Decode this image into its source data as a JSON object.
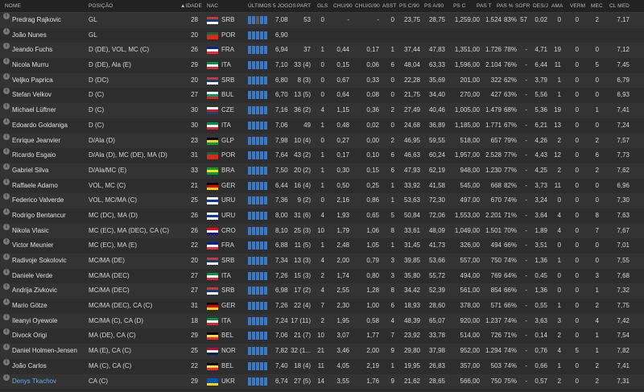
{
  "columns": {
    "nome": "NOME",
    "posicao": "POSIÇÃO",
    "idade": "IDADE",
    "nac": "NAC",
    "form": "ÚLTIMOS 5 JOGOS",
    "part": "PART",
    "gls": "GLS",
    "chu90": "CHU/90",
    "chug90": "CHU/G/90",
    "asst": "ASST",
    "psc90": "PS C/90",
    "pa90": "PS A/90",
    "psc": "PS C",
    "past": "PAS T",
    "paspct": "PAS %",
    "sofr": "SOFR",
    "desj": "DES/J",
    "ama": "AMA",
    "verm": "VERM",
    "mec": "MEC",
    "clmed": "CL MED"
  },
  "players": [
    {
      "name": "Predrag Rajkovic",
      "pos": "GL",
      "age": "28",
      "nat": "SRB",
      "form": [
        9,
        7,
        4,
        9,
        9
      ],
      "rating": "7,08",
      "part": "53",
      "gls": "0",
      "chu90": "-",
      "chug90": "-",
      "asst": "0",
      "psc90": "23,75",
      "pa90": "28,75",
      "psc": "1,259,00",
      "past": "1.524",
      "paspct": "83%",
      "sofr": "57",
      "desj": "0,02",
      "ama": "0",
      "verm": "0",
      "mec": "2",
      "clmed": "7,17"
    },
    {
      "name": "João Nunes",
      "pos": "GL",
      "age": "20",
      "nat": "POR",
      "form": [
        9,
        9,
        9,
        9,
        9
      ],
      "rating": "6,90",
      "part": "",
      "gls": "",
      "chu90": "",
      "chug90": "",
      "asst": "",
      "psc90": "",
      "pa90": "",
      "psc": "",
      "past": "",
      "paspct": "",
      "sofr": "",
      "desj": "",
      "ama": "",
      "verm": "",
      "mec": "",
      "clmed": ""
    },
    {
      "name": "Jeando Fuchs",
      "pos": "D (DE), VOL, MC (C)",
      "age": "26",
      "nat": "FRA",
      "form": [
        9,
        7,
        9,
        9,
        9
      ],
      "rating": "6,94",
      "part": "37",
      "gls": "1",
      "chu90": "0,44",
      "chug90": "0,17",
      "asst": "1",
      "psc90": "37,44",
      "pa90": "47,83",
      "psc": "1,351,00",
      "past": "1.726",
      "paspct": "78%",
      "sofr": "-",
      "desj": "4,71",
      "ama": "19",
      "verm": "0",
      "mec": "0",
      "clmed": "7,12"
    },
    {
      "name": "Nicola Murru",
      "pos": "D (DE), Ala (E)",
      "age": "29",
      "nat": "ITA",
      "form": [
        9,
        9,
        9,
        9,
        9
      ],
      "rating": "7,10",
      "part": "33 (4)",
      "gls": "0",
      "chu90": "0,15",
      "chug90": "0,06",
      "asst": "6",
      "psc90": "48,04",
      "pa90": "63,33",
      "psc": "1,596,00",
      "past": "2.104",
      "paspct": "76%",
      "sofr": "-",
      "desj": "6,44",
      "ama": "11",
      "verm": "0",
      "mec": "5",
      "clmed": "7,45"
    },
    {
      "name": "Veljko Paprica",
      "pos": "D (DC)",
      "age": "20",
      "nat": "SRB",
      "form": [
        9,
        9,
        9,
        9,
        9
      ],
      "rating": "6,80",
      "part": "8 (3)",
      "gls": "0",
      "chu90": "0,67",
      "chug90": "0,33",
      "asst": "0",
      "psc90": "22,28",
      "pa90": "35,69",
      "psc": "201,00",
      "past": "322",
      "paspct": "62%",
      "sofr": "-",
      "desj": "3,79",
      "ama": "1",
      "verm": "0",
      "mec": "0",
      "clmed": "6,79"
    },
    {
      "name": "Stefan Velkov",
      "pos": "D (C)",
      "age": "27",
      "nat": "BUL",
      "form": [
        9,
        9,
        9,
        9,
        9
      ],
      "rating": "6,70",
      "part": "13 (5)",
      "gls": "0",
      "chu90": "0,64",
      "chug90": "0,08",
      "asst": "0",
      "psc90": "21,75",
      "pa90": "34,40",
      "psc": "270,00",
      "past": "427",
      "paspct": "63%",
      "sofr": "-",
      "desj": "5,56",
      "ama": "1",
      "verm": "0",
      "mec": "0",
      "clmed": "6,93"
    },
    {
      "name": "Michael Lüftner",
      "pos": "D (C)",
      "age": "30",
      "nat": "CZE",
      "form": [
        9,
        9,
        9,
        9,
        9
      ],
      "rating": "7,16",
      "part": "36 (2)",
      "gls": "4",
      "chu90": "1,15",
      "chug90": "0,36",
      "asst": "2",
      "psc90": "27,49",
      "pa90": "40,46",
      "psc": "1,005,00",
      "past": "1.479",
      "paspct": "68%",
      "sofr": "-",
      "desj": "5,36",
      "ama": "19",
      "verm": "0",
      "mec": "1",
      "clmed": "7,41"
    },
    {
      "name": "Edoardo Goldaniga",
      "pos": "D (C)",
      "age": "30",
      "nat": "ITA",
      "form": [
        9,
        9,
        9,
        9,
        9
      ],
      "rating": "7,06",
      "part": "49",
      "gls": "1",
      "chu90": "0,48",
      "chug90": "0,02",
      "asst": "0",
      "psc90": "24,68",
      "pa90": "36,89",
      "psc": "1,185,00",
      "past": "1.771",
      "paspct": "67%",
      "sofr": "-",
      "desj": "6,21",
      "ama": "13",
      "verm": "0",
      "mec": "0",
      "clmed": "7,24"
    },
    {
      "name": "Enrique Jeanvier",
      "pos": "D/Ala (D)",
      "age": "23",
      "nat": "GLP",
      "form": [
        9,
        9,
        9,
        9,
        9
      ],
      "rating": "7,98",
      "part": "10 (4)",
      "gls": "0",
      "chu90": "0,27",
      "chug90": "0,00",
      "asst": "2",
      "psc90": "46,95",
      "pa90": "59,55",
      "psc": "518,00",
      "past": "657",
      "paspct": "79%",
      "sofr": "-",
      "desj": "4,26",
      "ama": "2",
      "verm": "0",
      "mec": "2",
      "clmed": "7,57"
    },
    {
      "name": "Ricardo Esgaio",
      "pos": "D/Ala (D), MC (DE), MA (D)",
      "age": "31",
      "nat": "POR",
      "form": [
        9,
        9,
        9,
        9,
        9
      ],
      "rating": "7,64",
      "part": "43 (2)",
      "gls": "1",
      "chu90": "0,17",
      "chug90": "0,10",
      "asst": "6",
      "psc90": "46,63",
      "pa90": "60,24",
      "psc": "1,957,00",
      "past": "2.528",
      "paspct": "77%",
      "sofr": "-",
      "desj": "4,43",
      "ama": "12",
      "verm": "0",
      "mec": "6",
      "clmed": "7,73"
    },
    {
      "name": "Gabriel Silva",
      "pos": "D/Ala/MC (E)",
      "age": "33",
      "nat": "BRA",
      "form": [
        9,
        9,
        9,
        9,
        9
      ],
      "rating": "7,50",
      "part": "20 (2)",
      "gls": "1",
      "chu90": "0,30",
      "chug90": "0,15",
      "asst": "6",
      "psc90": "47,93",
      "pa90": "62,19",
      "psc": "948,00",
      "past": "1.230",
      "paspct": "77%",
      "sofr": "-",
      "desj": "4,25",
      "ama": "2",
      "verm": "0",
      "mec": "2",
      "clmed": "7,62"
    },
    {
      "name": "Raffaele Adamo",
      "pos": "VOL, MC (C)",
      "age": "21",
      "nat": "GER",
      "form": [
        9,
        9,
        9,
        9,
        9
      ],
      "rating": "6,44",
      "part": "16 (4)",
      "gls": "1",
      "chu90": "0,50",
      "chug90": "0,25",
      "asst": "1",
      "psc90": "33,92",
      "pa90": "41,58",
      "psc": "545,00",
      "past": "668",
      "paspct": "82%",
      "sofr": "-",
      "desj": "3,73",
      "ama": "11",
      "verm": "0",
      "mec": "0",
      "clmed": "6,96"
    },
    {
      "name": "Federico Valverde",
      "pos": "VOL, MC/MA (C)",
      "age": "25",
      "nat": "URU",
      "form": [
        9,
        9,
        9,
        9,
        9
      ],
      "rating": "7,36",
      "part": "9 (2)",
      "gls": "0",
      "chu90": "2,16",
      "chug90": "0,86",
      "asst": "1",
      "psc90": "53,63",
      "pa90": "72,30",
      "psc": "497,00",
      "past": "670",
      "paspct": "74%",
      "sofr": "-",
      "desj": "3,24",
      "ama": "0",
      "verm": "0",
      "mec": "0",
      "clmed": "7,30"
    },
    {
      "name": "Rodrigo Bentancur",
      "pos": "MC (DC), MA (D)",
      "age": "26",
      "nat": "URU",
      "form": [
        9,
        9,
        9,
        9,
        9
      ],
      "rating": "8,00",
      "part": "31 (6)",
      "gls": "4",
      "chu90": "1,93",
      "chug90": "0,65",
      "asst": "5",
      "psc90": "50,84",
      "pa90": "72,06",
      "psc": "1,553,00",
      "past": "2.201",
      "paspct": "71%",
      "sofr": "-",
      "desj": "3,64",
      "ama": "4",
      "verm": "0",
      "mec": "8",
      "clmed": "7,63"
    },
    {
      "name": "Nikola Vlasic",
      "pos": "MC (EC), MA (DEC), CA (C)",
      "age": "26",
      "nat": "CRO",
      "form": [
        9,
        9,
        9,
        9,
        9
      ],
      "rating": "8,10",
      "part": "25 (3)",
      "gls": "10",
      "chu90": "1,79",
      "chug90": "1,06",
      "asst": "8",
      "psc90": "33,61",
      "pa90": "48,09",
      "psc": "1,049,00",
      "past": "1.501",
      "paspct": "70%",
      "sofr": "-",
      "desj": "1,89",
      "ama": "4",
      "verm": "0",
      "mec": "7",
      "clmed": "7,67"
    },
    {
      "name": "Victor Meunier",
      "pos": "MC (EC), MA (E)",
      "age": "22",
      "nat": "FRA",
      "form": [
        9,
        9,
        9,
        9,
        9
      ],
      "rating": "6,88",
      "part": "11 (5)",
      "gls": "1",
      "chu90": "2,48",
      "chug90": "1,05",
      "asst": "1",
      "psc90": "31,45",
      "pa90": "41,73",
      "psc": "326,00",
      "past": "494",
      "paspct": "66%",
      "sofr": "-",
      "desj": "3,51",
      "ama": "0",
      "verm": "0",
      "mec": "0",
      "clmed": "7,01"
    },
    {
      "name": "Radivoje Sokolovic",
      "pos": "MC/MA (DE)",
      "age": "20",
      "nat": "SRB",
      "form": [
        9,
        9,
        9,
        9,
        9
      ],
      "rating": "7,34",
      "part": "13 (3)",
      "gls": "4",
      "chu90": "2,00",
      "chug90": "0,79",
      "asst": "3",
      "psc90": "39,85",
      "pa90": "53,66",
      "psc": "557,00",
      "past": "750",
      "paspct": "74%",
      "sofr": "-",
      "desj": "1,36",
      "ama": "1",
      "verm": "0",
      "mec": "0",
      "clmed": "7,55"
    },
    {
      "name": "Daniele Verde",
      "pos": "MC/MA (DEC)",
      "age": "27",
      "nat": "ITA",
      "form": [
        9,
        9,
        9,
        9,
        9
      ],
      "rating": "7,26",
      "part": "15 (3)",
      "gls": "2",
      "chu90": "1,74",
      "chug90": "0,80",
      "asst": "3",
      "psc90": "35,80",
      "pa90": "55,72",
      "psc": "494,00",
      "past": "769",
      "paspct": "64%",
      "sofr": "-",
      "desj": "0,45",
      "ama": "0",
      "verm": "0",
      "mec": "3",
      "clmed": "7,68"
    },
    {
      "name": "Andrija Zivkovic",
      "pos": "MC/MA (DEC)",
      "age": "27",
      "nat": "SRB",
      "form": [
        9,
        9,
        9,
        9,
        9
      ],
      "rating": "6,98",
      "part": "17 (2)",
      "gls": "4",
      "chu90": "2,55",
      "chug90": "1,28",
      "asst": "8",
      "psc90": "34,42",
      "pa90": "52,39",
      "psc": "561,00",
      "past": "854",
      "paspct": "66%",
      "sofr": "-",
      "desj": "1,36",
      "ama": "0",
      "verm": "0",
      "mec": "1",
      "clmed": "7,32"
    },
    {
      "name": "Mario Götze",
      "pos": "MC/MA (DEC), CA (C)",
      "age": "31",
      "nat": "GER",
      "form": [
        9,
        9,
        9,
        9,
        9
      ],
      "rating": "7,26",
      "part": "22 (4)",
      "gls": "7",
      "chu90": "2,30",
      "chug90": "1,00",
      "asst": "6",
      "psc90": "18,93",
      "pa90": "28,60",
      "psc": "378,00",
      "past": "571",
      "paspct": "66%",
      "sofr": "-",
      "desj": "0,55",
      "ama": "1",
      "verm": "0",
      "mec": "2",
      "clmed": "7,75"
    },
    {
      "name": "Ileanyi Oyewole",
      "pos": "MC/MA (C), CA (D)",
      "age": "18",
      "nat": "ITA",
      "form": [
        9,
        9,
        9,
        9,
        9
      ],
      "rating": "7,24",
      "part": "17 (11)",
      "gls": "2",
      "chu90": "1,95",
      "chug90": "0,58",
      "asst": "4",
      "psc90": "48,39",
      "pa90": "65,07",
      "psc": "920,00",
      "past": "1.237",
      "paspct": "74%",
      "sofr": "-",
      "desj": "3,63",
      "ama": "3",
      "verm": "0",
      "mec": "4",
      "clmed": "7,42"
    },
    {
      "name": "Divock Origi",
      "pos": "MA (DE), CA (C)",
      "age": "29",
      "nat": "BEL",
      "form": [
        9,
        9,
        9,
        9,
        9
      ],
      "rating": "7,06",
      "part": "21 (7)",
      "gls": "10",
      "chu90": "3,07",
      "chug90": "1,77",
      "asst": "7",
      "psc90": "23,92",
      "pa90": "33,78",
      "psc": "514,00",
      "past": "726",
      "paspct": "71%",
      "sofr": "-",
      "desj": "0,14",
      "ama": "2",
      "verm": "0",
      "mec": "1",
      "clmed": "7,54"
    },
    {
      "name": "Daniel Holmen-Jensen",
      "pos": "MA (E), CA (C)",
      "age": "25",
      "nat": "NOR",
      "form": [
        9,
        9,
        9,
        9,
        9
      ],
      "rating": "7,82",
      "part": "32 (1...",
      "gls": "21",
      "chu90": "3,46",
      "chug90": "2,00",
      "asst": "9",
      "psc90": "29,80",
      "pa90": "37,98",
      "psc": "952,00",
      "past": "1.294",
      "paspct": "74%",
      "sofr": "-",
      "desj": "0,76",
      "ama": "4",
      "verm": "5",
      "mec": "1",
      "clmed": "7,82"
    },
    {
      "name": "João Carlos",
      "pos": "MA (C), CA (C)",
      "age": "22",
      "nat": "BEL",
      "form": [
        9,
        9,
        9,
        9,
        9
      ],
      "rating": "7,40",
      "part": "18 (4)",
      "gls": "11",
      "chu90": "4,05",
      "chug90": "2,19",
      "asst": "1",
      "psc90": "19,95",
      "pa90": "26,83",
      "psc": "357,00",
      "past": "503",
      "paspct": "74%",
      "sofr": "-",
      "desj": "0,66",
      "ama": "1",
      "verm": "0",
      "mec": "2",
      "clmed": "7,41"
    },
    {
      "name": "Denys Tkachov",
      "pos": "CA (C)",
      "age": "29",
      "nat": "UKR",
      "form": [
        9,
        9,
        9,
        9,
        9
      ],
      "rating": "6,74",
      "part": "27 (5)",
      "gls": "14",
      "chu90": "3,55",
      "chug90": "1,76",
      "asst": "9",
      "psc90": "21,62",
      "pa90": "28,65",
      "psc": "566,00",
      "past": "750",
      "paspct": "75%",
      "sofr": "-",
      "desj": "0,57",
      "ama": "2",
      "verm": "0",
      "mec": "2",
      "clmed": "7,31"
    }
  ],
  "flags": {
    "SRB": [
      "#c6363c",
      "#0c4076",
      "#ffffff"
    ],
    "POR": [
      "#046a38",
      "#da291c",
      "#da291c"
    ],
    "FRA": [
      "#002395",
      "#ffffff",
      "#ed2939"
    ],
    "ITA": [
      "#009246",
      "#ffffff",
      "#ce2b37"
    ],
    "BUL": [
      "#ffffff",
      "#00966e",
      "#d62612"
    ],
    "CZE": [
      "#ffffff",
      "#d7141a",
      "#11457e"
    ],
    "GLP": [
      "#000000",
      "#f7d117",
      "#009e49"
    ],
    "BRA": [
      "#009c3b",
      "#ffdf00",
      "#009c3b"
    ],
    "GER": [
      "#000000",
      "#dd0000",
      "#ffce00"
    ],
    "URU": [
      "#ffffff",
      "#0038a8",
      "#ffffff"
    ],
    "CRO": [
      "#ff0000",
      "#ffffff",
      "#171796"
    ],
    "BEL": [
      "#000000",
      "#fae042",
      "#ed2939"
    ],
    "NOR": [
      "#ba0c2f",
      "#ffffff",
      "#00205b"
    ],
    "UKR": [
      "#0057b7",
      "#0057b7",
      "#ffd700"
    ]
  },
  "highlight_player": "Denys Tkachov"
}
